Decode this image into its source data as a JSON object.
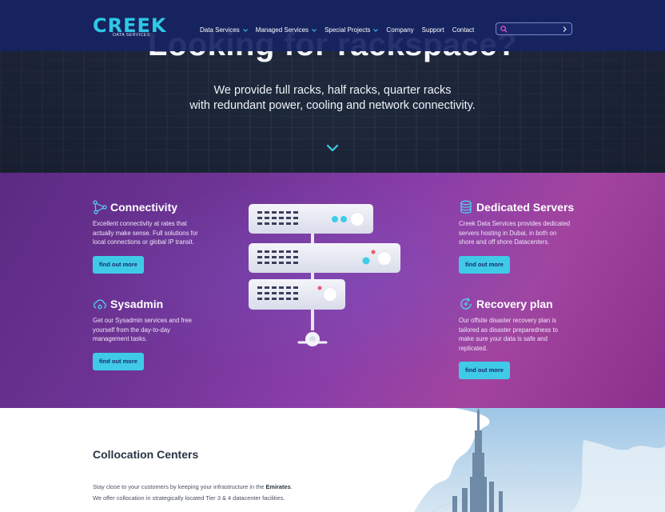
{
  "nav": {
    "logo_word": "CREEK",
    "logo_tagline": "DATA SERVICES",
    "items": [
      {
        "label": "Data Services",
        "has_caret": true
      },
      {
        "label": "Managed Services",
        "has_caret": true
      },
      {
        "label": "Special Projects",
        "has_caret": true
      },
      {
        "label": "Company",
        "has_caret": false
      },
      {
        "label": "Support",
        "has_caret": false
      },
      {
        "label": "Contact",
        "has_caret": false
      }
    ],
    "search_placeholder": ""
  },
  "hero": {
    "title": "Looking for rackspace?",
    "subtitle_line1": "We provide full racks, half racks, quarter racks",
    "subtitle_line2": "with redundant power, cooling and network connectivity."
  },
  "services": [
    {
      "title": "Connectivity",
      "icon": "network-nodes-icon",
      "body": "Excellent connectivity at rates that actually make sense. Full solutions for local connections or global IP transit.",
      "button": "find out more"
    },
    {
      "title": "Sysadmin",
      "icon": "cloud-gear-icon",
      "body": "Get our Sysadmin services and free yourself from the day-to-day management tasks.",
      "button": "find out more"
    },
    {
      "title": "Dedicated Servers",
      "icon": "database-icon",
      "body": "Creek Data Services provides dedicated servers hosting in Dubai, in both on shore and off shore Datacenters.",
      "button": "find out more"
    },
    {
      "title": "Recovery plan",
      "icon": "recovery-refresh-icon",
      "body": "Our offsite disaster recovery plan is tailored as disaster preparedness to make sure your data is safe and replicated.",
      "button": "find out more"
    }
  ],
  "colocation": {
    "title": "Collocation Centers",
    "line1_before": "Stay close to your customers by keeping your infrastructure in the ",
    "line1_bold": "Emirates",
    "line1_after": ".",
    "line2": "We offer collocation in strategically located Tier 3 & 4 datacenter facilities."
  },
  "colors": {
    "nav_bg": "#162462",
    "accent": "#3fcbe8",
    "services_gradient_start": "#5b2a82",
    "services_gradient_end": "#a2449f"
  }
}
